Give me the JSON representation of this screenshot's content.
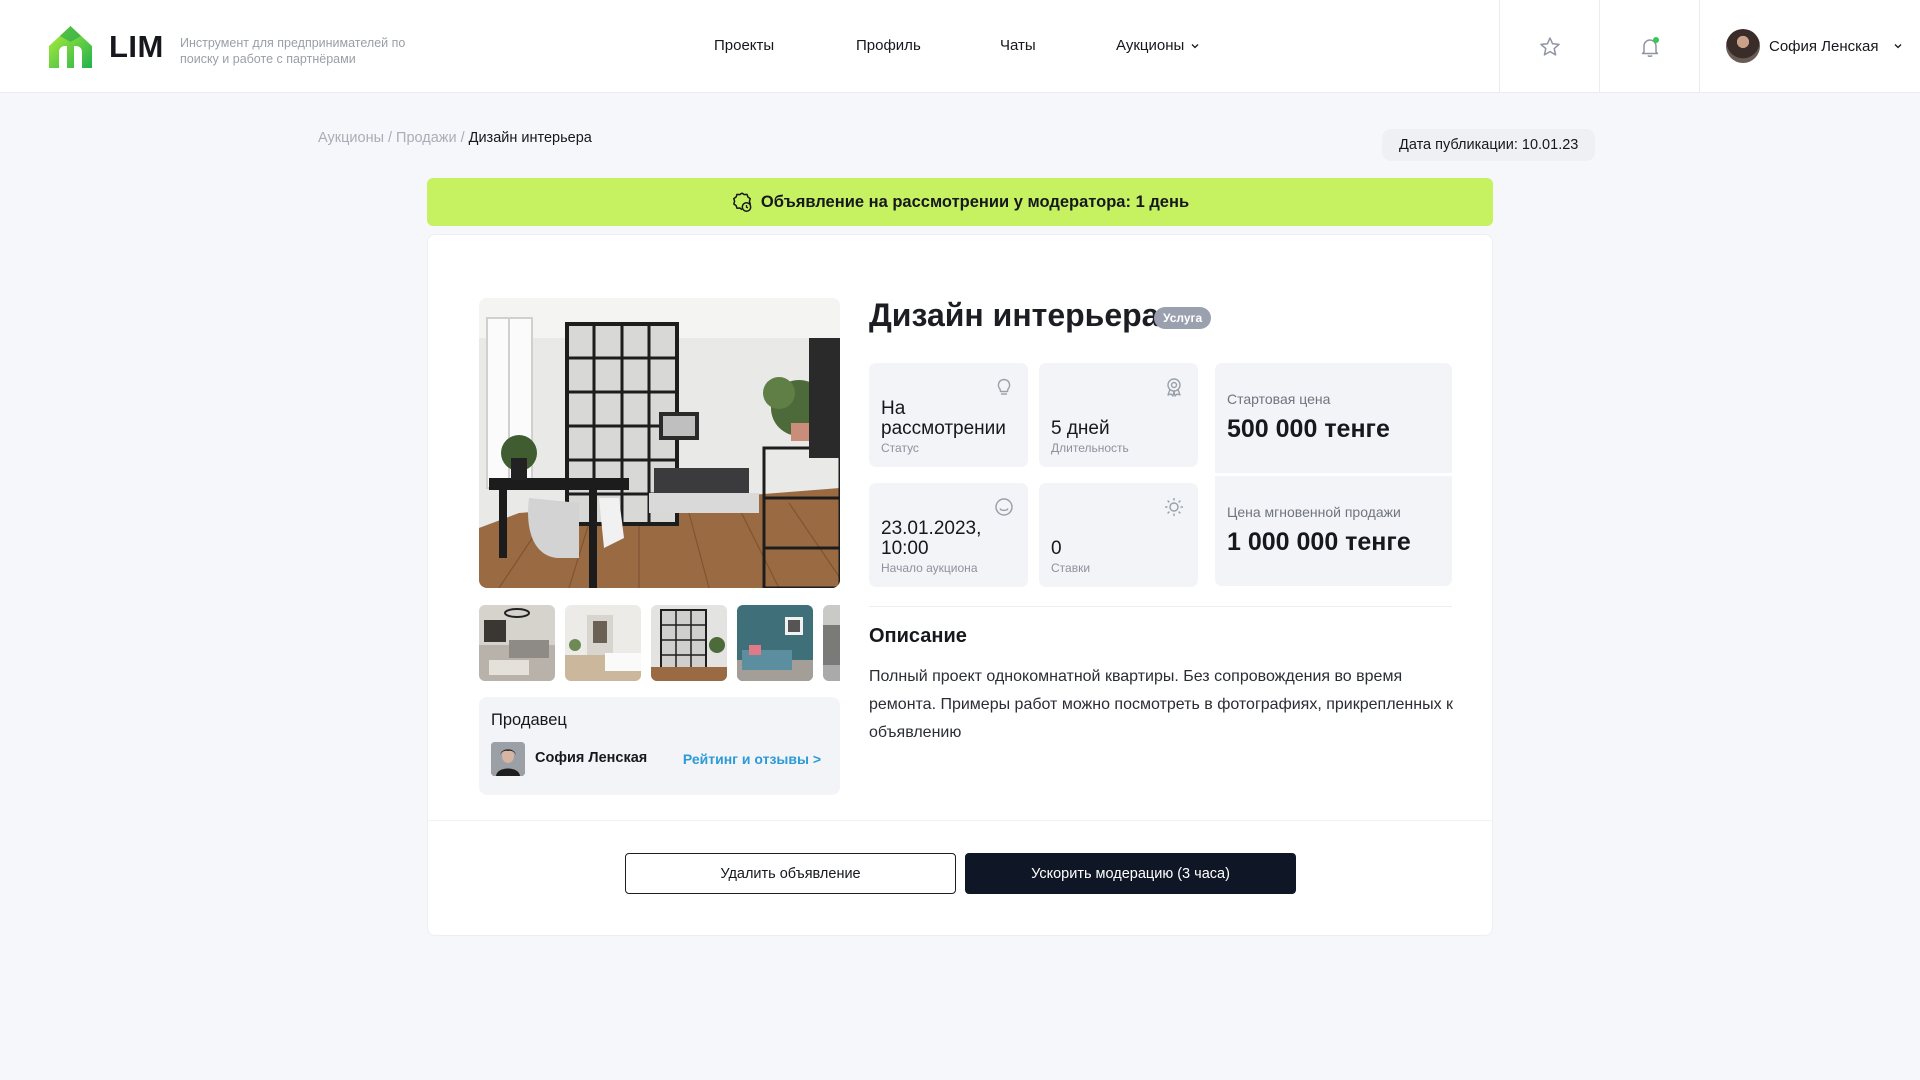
{
  "header": {
    "logo_text": "LIM",
    "tagline": "Инструмент для предпринимателей по поиску и работе с партнёрами",
    "nav": {
      "projects": "Проекты",
      "profile": "Профиль",
      "chats": "Чаты",
      "auctions": "Аукционы"
    },
    "user_name": "София Ленская",
    "accent_color": "#34c759"
  },
  "breadcrumb": {
    "items": [
      "Аукционы",
      "Продажи",
      "Дизайн интерьера"
    ],
    "separator": "/"
  },
  "publication_date": "Дата публикации: 10.01.23",
  "banner": {
    "text": "Объявление на рассмотрении у модератора: 1 день",
    "color": "#c6f262"
  },
  "lot": {
    "title": "Дизайн интерьера",
    "badge": "Услуга",
    "stats": {
      "status": {
        "value": "На рассмотрении",
        "label": "Статус",
        "icon": "lightbulb-icon"
      },
      "duration": {
        "value": "5 дней",
        "label": "Длительность",
        "icon": "award-icon"
      },
      "start": {
        "value": "23.01.2023, 10:00",
        "label": "Начало аукциона",
        "icon": "clock-icon"
      },
      "bids": {
        "value": "0",
        "label": "Ставки",
        "icon": "sun-icon"
      }
    },
    "prices": {
      "start_label": "Стартовая цена",
      "start_value": "500 000 тенге",
      "instant_label": "Цена мгновенной продажи",
      "instant_value": "1 000 000 тенге"
    },
    "description_title": "Описание",
    "description": "Полный проект однокомнатной квартиры. Без сопровождения во время ремонта. Примеры работ можно посмотреть в фотографиях, прикрепленных к объявлению"
  },
  "seller": {
    "title": "Продавец",
    "name": "София Ленская",
    "rating_link": "Рейтинг и отзывы >"
  },
  "actions": {
    "delete": "Удалить объявление",
    "boost": "Ускорить модерацию (3 часа)"
  }
}
